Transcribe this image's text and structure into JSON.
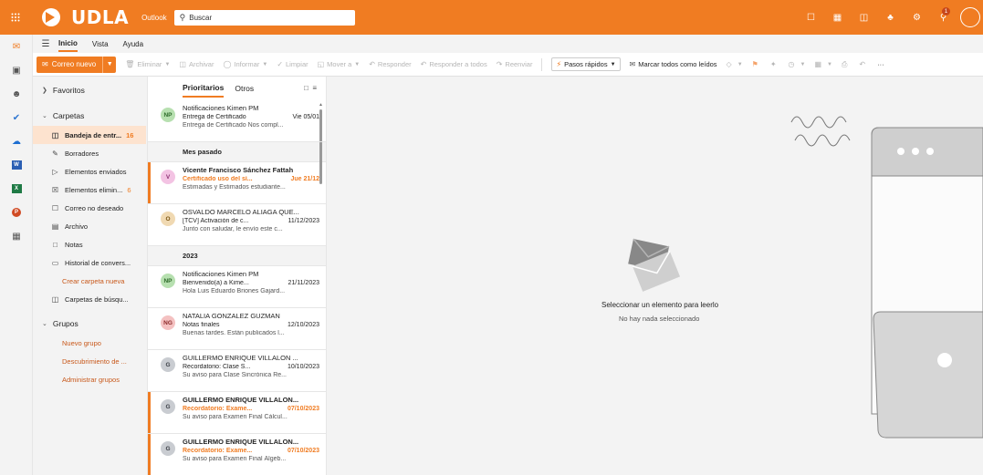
{
  "colors": {
    "brand": "#f07c22",
    "unread_accent": "#f07c22"
  },
  "topbar": {
    "brand_name": "UDLA",
    "app_name": "Outlook",
    "search_placeholder": "Buscar",
    "notification_count": "1"
  },
  "ribbon": {
    "tabs": [
      "Inicio",
      "Vista",
      "Ayuda"
    ],
    "new_mail": "Correo nuevo",
    "delete": "Eliminar",
    "archive": "Archivar",
    "report": "Informar",
    "sweep": "Limpiar",
    "move": "Mover a",
    "reply": "Responder",
    "reply_all": "Responder a todos",
    "forward": "Reenviar",
    "quick_steps": "Pasos rápidos",
    "mark_all_read": "Marcar todos como leídos",
    "more": "···"
  },
  "folders": {
    "favorites": "Favoritos",
    "folders_header": "Carpetas",
    "items": [
      {
        "label": "Bandeja de entr...",
        "count": "16"
      },
      {
        "label": "Borradores",
        "count": ""
      },
      {
        "label": "Elementos enviados",
        "count": ""
      },
      {
        "label": "Elementos elimin...",
        "count": "6"
      },
      {
        "label": "Correo no deseado",
        "count": ""
      },
      {
        "label": "Archivo",
        "count": ""
      },
      {
        "label": "Notas",
        "count": ""
      },
      {
        "label": "Historial de convers...",
        "count": ""
      }
    ],
    "create_folder": "Crear carpeta nueva",
    "search_folders": "Carpetas de búsqu...",
    "groups_header": "Grupos",
    "new_group": "Nuevo grupo",
    "discover_groups": "Descubrimiento de ...",
    "manage_groups": "Administrar grupos"
  },
  "message_list": {
    "tab_focused": "Prioritarios",
    "tab_other": "Otros",
    "group_last_month": "Mes pasado",
    "group_2023": "2023",
    "messages": [
      {
        "initials": "NP",
        "avatar_bg": "#b7e0b0",
        "avatar_fg": "#2e6b2a",
        "from": "Notificaciones Kimen PM",
        "subject": "Entrega de Certificado",
        "date": "Vie 05/01",
        "preview": "Entrega de Certificado Nos compl...",
        "unread": false
      },
      {
        "initials": "V",
        "avatar_bg": "#f3c3e3",
        "avatar_fg": "#8b2f72",
        "from": "Vicente Francisco Sánchez Fattah",
        "subject": "Certificado uso del sí...",
        "date": "Jue 21/12",
        "preview": "Estimadas y Estimados estudiante...",
        "unread": true
      },
      {
        "initials": "O",
        "avatar_bg": "#f0d9b2",
        "avatar_fg": "#7a5512",
        "from": "OSVALDO MARCELO ALIAGA QUE...",
        "subject": "[TCV] Activación de c...",
        "date": "11/12/2023",
        "preview": "Junto con saludar, le envío este c...",
        "unread": false
      },
      {
        "initials": "NP",
        "avatar_bg": "#b7e0b0",
        "avatar_fg": "#2e6b2a",
        "from": "Notificaciones Kimen PM",
        "subject": "Bienvenido(a) a Kime...",
        "date": "21/11/2023",
        "preview": "Hola Luis Eduardo Briones Gajard...",
        "unread": false
      },
      {
        "initials": "NG",
        "avatar_bg": "#f4c1c1",
        "avatar_fg": "#8c2a2a",
        "from": "NATALIA GONZALEZ GUZMAN",
        "subject": "Notas finales",
        "date": "12/10/2023",
        "preview": "Buenas tardes. Están publicados l...",
        "unread": false
      },
      {
        "initials": "G",
        "avatar_bg": "#c9ccd1",
        "avatar_fg": "#3d4148",
        "from": "GUILLERMO ENRIQUE VILLALON ...",
        "subject": "Recordatorio: Clase S...",
        "date": "10/10/2023",
        "preview": "Su aviso para Clase Sincrónica Re...",
        "unread": false
      },
      {
        "initials": "G",
        "avatar_bg": "#c9ccd1",
        "avatar_fg": "#3d4148",
        "from": "GUILLERMO ENRIQUE VILLALON...",
        "subject": "Recordatorio: Exame...",
        "date": "07/10/2023",
        "preview": "Su aviso para Examen Final Cálcul...",
        "unread": true
      },
      {
        "initials": "G",
        "avatar_bg": "#c9ccd1",
        "avatar_fg": "#3d4148",
        "from": "GUILLERMO ENRIQUE VILLALON...",
        "subject": "Recordatorio: Exame...",
        "date": "07/10/2023",
        "preview": "Su aviso para Examen Final Álgeb...",
        "unread": true
      }
    ]
  },
  "reading_pane": {
    "title": "Seleccionar un elemento para leerlo",
    "subtitle": "No hay nada seleccionado"
  }
}
